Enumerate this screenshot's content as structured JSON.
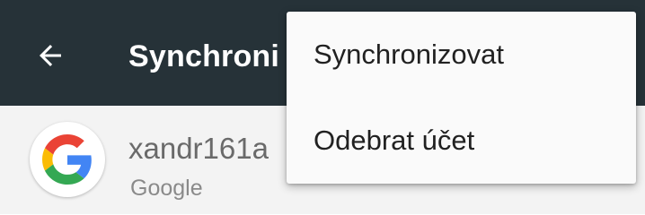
{
  "toolbar": {
    "title": "Synchroni",
    "back_icon": "arrow-back-icon",
    "background": "#263238"
  },
  "account": {
    "email": "xandr161a",
    "type": "Google",
    "avatar_icon": "google-logo-icon"
  },
  "menu": {
    "items": [
      {
        "label": "Synchronizovat"
      },
      {
        "label": "Odebrat účet"
      }
    ]
  }
}
